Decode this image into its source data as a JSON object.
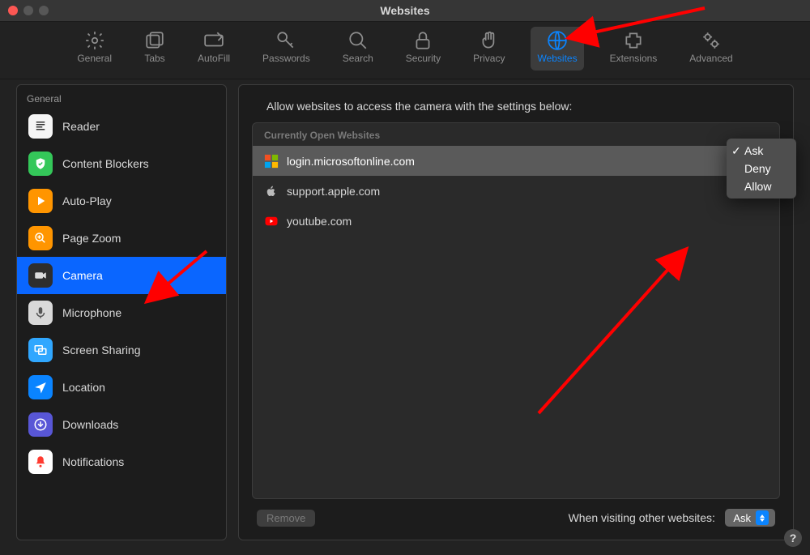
{
  "window": {
    "title": "Websites"
  },
  "toolbar": {
    "items": [
      {
        "id": "general",
        "label": "General"
      },
      {
        "id": "tabs",
        "label": "Tabs"
      },
      {
        "id": "autofill",
        "label": "AutoFill"
      },
      {
        "id": "passwords",
        "label": "Passwords"
      },
      {
        "id": "search",
        "label": "Search"
      },
      {
        "id": "security",
        "label": "Security"
      },
      {
        "id": "privacy",
        "label": "Privacy"
      },
      {
        "id": "websites",
        "label": "Websites",
        "selected": true
      },
      {
        "id": "extensions",
        "label": "Extensions"
      },
      {
        "id": "advanced",
        "label": "Advanced"
      }
    ]
  },
  "sidebar": {
    "header": "General",
    "items": [
      {
        "id": "reader",
        "label": "Reader"
      },
      {
        "id": "content-blockers",
        "label": "Content Blockers"
      },
      {
        "id": "auto-play",
        "label": "Auto-Play"
      },
      {
        "id": "page-zoom",
        "label": "Page Zoom"
      },
      {
        "id": "camera",
        "label": "Camera",
        "selected": true
      },
      {
        "id": "microphone",
        "label": "Microphone"
      },
      {
        "id": "screen-sharing",
        "label": "Screen Sharing"
      },
      {
        "id": "location",
        "label": "Location"
      },
      {
        "id": "downloads",
        "label": "Downloads"
      },
      {
        "id": "notifications",
        "label": "Notifications"
      }
    ]
  },
  "main": {
    "heading": "Allow websites to access the camera with the settings below:",
    "list_header": "Currently Open Websites",
    "rows": [
      {
        "site": "login.microsoftonline.com",
        "icon": "microsoft",
        "selected": true
      },
      {
        "site": "support.apple.com",
        "icon": "apple"
      },
      {
        "site": "youtube.com",
        "icon": "youtube"
      }
    ],
    "remove_label": "Remove",
    "other_sites_label": "When visiting other websites:",
    "other_sites_value": "Ask",
    "popup": {
      "options": [
        {
          "label": "Ask",
          "checked": true
        },
        {
          "label": "Deny"
        },
        {
          "label": "Allow"
        }
      ]
    }
  },
  "help": {
    "glyph": "?"
  }
}
